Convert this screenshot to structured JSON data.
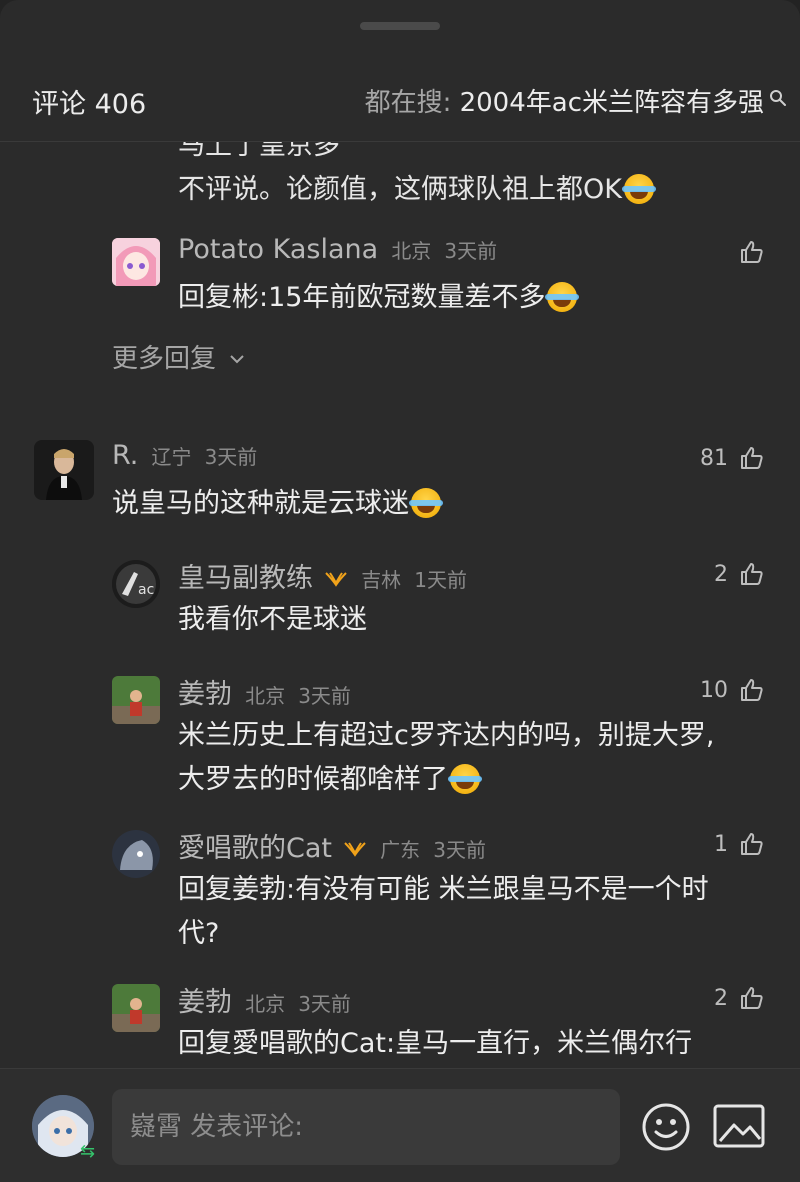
{
  "header": {
    "count_label": "评论 406",
    "search_prefix": "都在搜: ",
    "search_query": "2004年ac米兰阵容有多强"
  },
  "clipped_comment": {
    "line1": "马上了皇京多",
    "line2": "不评说。论颜值，这俩球队祖上都OK"
  },
  "reply_potato": {
    "name": "Potato Kaslana",
    "location": "北京",
    "time": "3天前",
    "text": "回复彬:15年前欧冠数量差不多"
  },
  "more_replies": "更多回复",
  "comment_r": {
    "name": "R.",
    "location": "辽宁",
    "time": "3天前",
    "likes": "81",
    "text": "说皇马的这种就是云球迷"
  },
  "reply_coach": {
    "name": "皇马副教练",
    "location": "吉林",
    "time": "1天前",
    "likes": "2",
    "text": "我看你不是球迷"
  },
  "reply_jiang1": {
    "name": "姜勃",
    "location": "北京",
    "time": "3天前",
    "likes": "10",
    "line1": "米兰历史上有超过c罗齐达内的吗，别提大罗,",
    "line2": "大罗去的时候都啥样了"
  },
  "reply_cat": {
    "name": "愛唱歌的Cat",
    "location": "广东",
    "time": "3天前",
    "likes": "1",
    "line1": "回复姜勃:有没有可能 米兰跟皇马不是一个时",
    "line2": "代?"
  },
  "reply_jiang2": {
    "name": "姜勃",
    "location": "北京",
    "time": "3天前",
    "likes": "2",
    "text": "回复愛唱歌的Cat:皇马一直行，米兰偶尔行"
  },
  "composer": {
    "username": "嶷霄",
    "placeholder": "发表评论:"
  },
  "icons": [
    "search-icon",
    "like-icon",
    "vip-icon",
    "emoji-icon",
    "image-icon",
    "chevron-down-icon"
  ]
}
